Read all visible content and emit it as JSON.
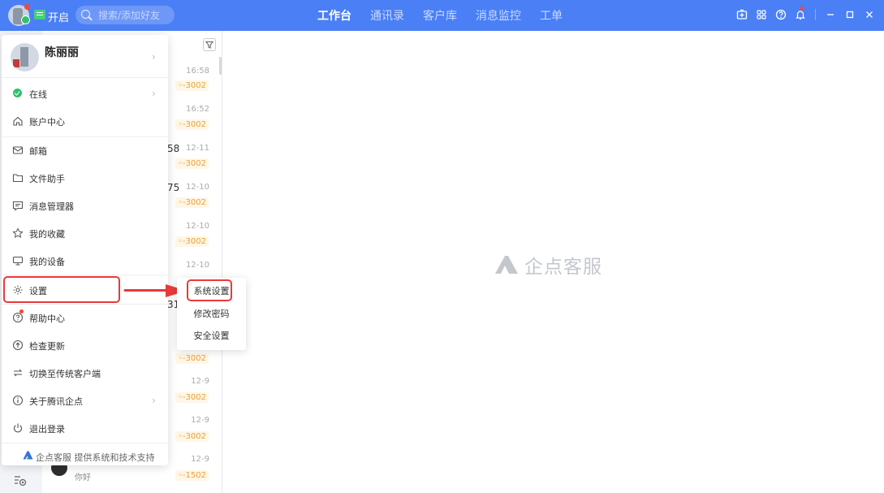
{
  "topbar": {
    "status_toggle_label": "开启",
    "search_placeholder": "搜索/添加好友",
    "tabs": [
      {
        "label": "工作台",
        "active": true
      },
      {
        "label": "通讯录",
        "active": false
      },
      {
        "label": "客户库",
        "active": false
      },
      {
        "label": "消息监控",
        "active": false
      },
      {
        "label": "工单",
        "active": false
      }
    ],
    "icons": [
      "add-icon",
      "grid-icon",
      "help-icon",
      "bell-icon",
      "minimize-icon",
      "maximize-icon",
      "close-icon"
    ],
    "accent_color": "#4a7ff5"
  },
  "chat_list": {
    "items": [
      {
        "time": "16:58",
        "badge": "-3002",
        "fragment": ""
      },
      {
        "time": "16:52",
        "badge": "-3002",
        "fragment": ""
      },
      {
        "time": "12-11",
        "badge": "-3002",
        "fragment": "58"
      },
      {
        "time": "12-10",
        "badge": "-3002",
        "fragment": "75"
      },
      {
        "time": "12-10",
        "badge": "-3002",
        "fragment": ""
      },
      {
        "time": "12-10",
        "badge": "",
        "fragment": ""
      },
      {
        "time": "",
        "badge": "",
        "fragment": "31"
      },
      {
        "time": "",
        "badge": "-3002",
        "fragment": ""
      },
      {
        "time": "12-9",
        "badge": "-3002",
        "fragment": ""
      },
      {
        "time": "12-9",
        "badge": "-3002",
        "fragment": ""
      },
      {
        "time": "12-9",
        "badge": "-1502",
        "fragment": "",
        "message": "你好"
      }
    ]
  },
  "main": {
    "watermark_text": "企点客服"
  },
  "profile_menu": {
    "user_name": "陈丽丽",
    "status_label": "在线",
    "items": [
      {
        "label": "账户中心",
        "icon": "home-icon"
      },
      {
        "label": "邮箱",
        "icon": "mail-icon"
      },
      {
        "label": "文件助手",
        "icon": "folder-icon"
      },
      {
        "label": "消息管理器",
        "icon": "message-icon"
      },
      {
        "label": "我的收藏",
        "icon": "star-icon"
      },
      {
        "label": "我的设备",
        "icon": "monitor-icon"
      },
      {
        "label": "设置",
        "icon": "settings-icon"
      },
      {
        "label": "帮助中心",
        "icon": "help-circle-icon"
      },
      {
        "label": "检查更新",
        "icon": "upload-icon"
      },
      {
        "label": "切换至传统客户端",
        "icon": "switch-icon"
      },
      {
        "label": "关于腾讯企点",
        "icon": "info-icon"
      },
      {
        "label": "退出登录",
        "icon": "power-icon"
      }
    ],
    "footer_text": "企点客服 提供系统和技术支持"
  },
  "settings_submenu": {
    "items": [
      "系统设置",
      "修改密码",
      "安全设置"
    ]
  },
  "annotation_color": "#e83a3a"
}
